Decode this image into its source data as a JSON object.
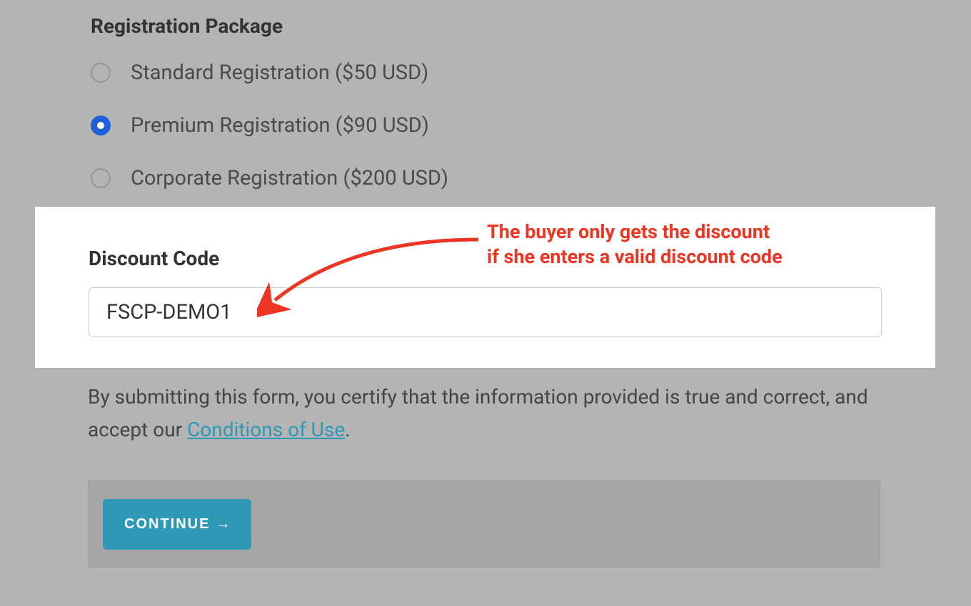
{
  "form": {
    "packageHeading": "Registration Package",
    "options": [
      {
        "label": "Standard Registration ($50 USD)",
        "selected": false
      },
      {
        "label": "Premium Registration ($90 USD)",
        "selected": true
      },
      {
        "label": "Corporate Registration ($200 USD)",
        "selected": false
      }
    ],
    "discount": {
      "label": "Discount Code",
      "value": "FSCP-DEMO1"
    },
    "disclaimer": {
      "prefix": "By submitting this form, you certify that the information provided is true and correct, and accept our ",
      "linkText": "Conditions of Use",
      "suffix": "."
    },
    "continueLabel": "CONTINUE"
  },
  "annotation": {
    "line1": "The buyer only gets the discount",
    "line2": "if she enters a valid discount code"
  }
}
